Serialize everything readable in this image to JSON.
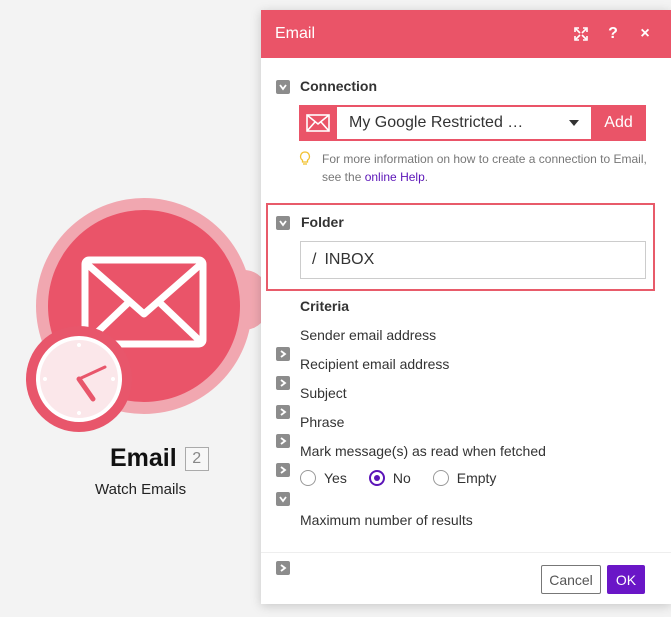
{
  "module": {
    "title": "Email",
    "badge": "2",
    "subtitle": "Watch Emails"
  },
  "dialog": {
    "title": "Email",
    "help_icon": "?",
    "close_icon": "×"
  },
  "connection": {
    "label": "Connection",
    "selected": "My Google Restricted …",
    "add_label": "Add",
    "hint_text": "For more information on how to create a connection to Email, see the ",
    "hint_link": "online Help",
    "hint_end": "."
  },
  "folder": {
    "label": "Folder",
    "prefix": "/",
    "value": "INBOX"
  },
  "criteria": {
    "label": "Criteria",
    "items": [
      "Sender email address",
      "Recipient email address",
      "Subject",
      "Phrase",
      "Mark message(s) as read when fetched"
    ],
    "mark_read_options": [
      "Yes",
      "No",
      "Empty"
    ],
    "mark_read_selected": "No",
    "max_results": "Maximum number of results"
  },
  "footer": {
    "cancel": "Cancel",
    "ok": "OK"
  },
  "colors": {
    "brand": "#ea5468",
    "primary_button": "#6a16c7",
    "link": "#5b14b8"
  },
  "icons": {
    "module": "envelope-icon",
    "trigger": "clock-icon",
    "fullscreen": "expand-icon",
    "help": "question-icon",
    "close": "close-icon",
    "hint": "lightbulb-icon"
  }
}
